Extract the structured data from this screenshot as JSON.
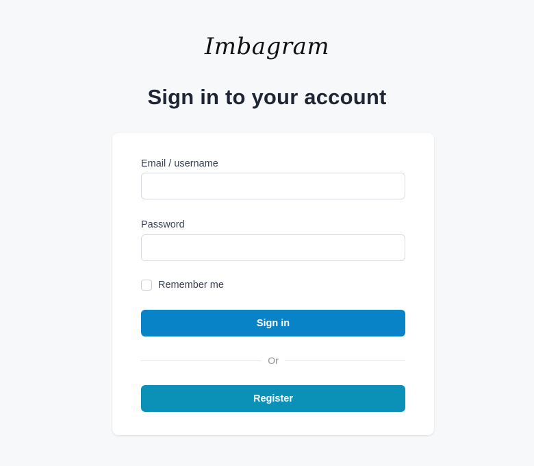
{
  "brand": {
    "logo_text": "Imbagram"
  },
  "heading": "Sign in to your account",
  "form": {
    "email_label": "Email / username",
    "email_value": "",
    "password_label": "Password",
    "password_value": "",
    "remember_label": "Remember me",
    "remember_checked": false,
    "signin_label": "Sign in",
    "divider_text": "Or",
    "register_label": "Register"
  },
  "colors": {
    "page_background": "#f7f8fa",
    "card_background": "#ffffff",
    "signin_button": "#0883c8",
    "register_button": "#0b90b8",
    "heading_text": "#1e2635"
  }
}
